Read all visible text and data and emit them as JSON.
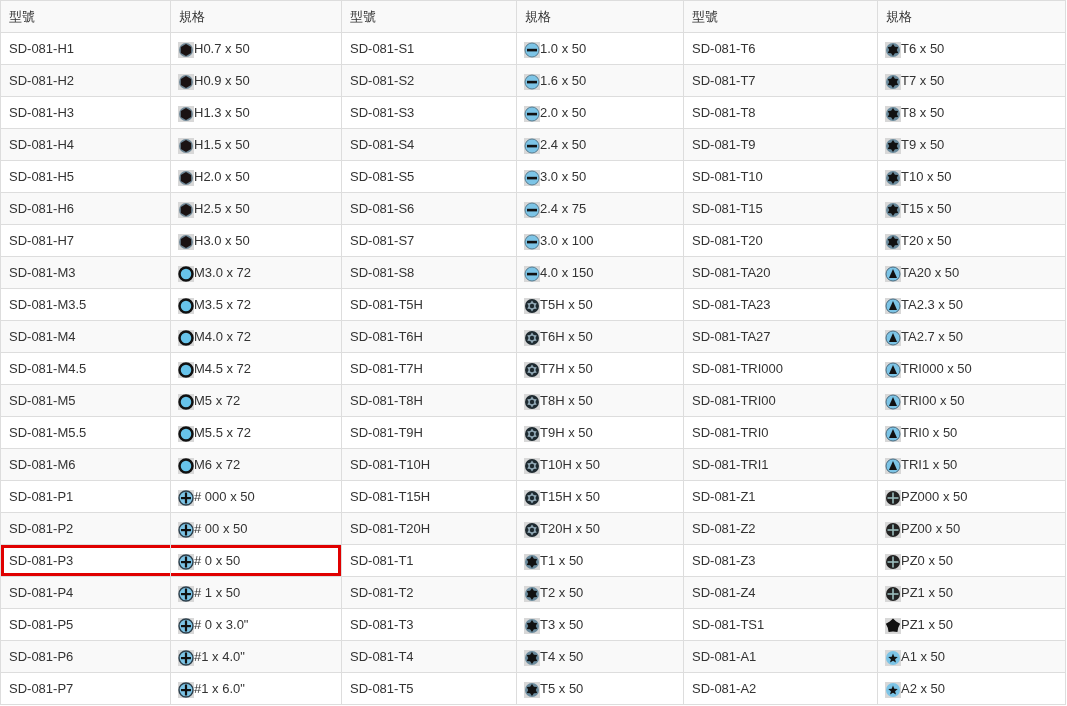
{
  "table": {
    "columns": [
      "型號",
      "規格",
      "型號",
      "規格",
      "型號",
      "規格"
    ],
    "rows": [
      {
        "items": [
          {
            "model": "SD-081-H1",
            "spec": "H0.7 x 50",
            "kind": "hex",
            "highlighted": false
          },
          {
            "model": "SD-081-S1",
            "spec": "1.0 x 50",
            "kind": "slot",
            "highlighted": false
          },
          {
            "model": "SD-081-T6",
            "spec": "T6 x 50",
            "kind": "torx",
            "highlighted": false
          }
        ]
      },
      {
        "items": [
          {
            "model": "SD-081-H2",
            "spec": "H0.9 x 50",
            "kind": "hex",
            "highlighted": false
          },
          {
            "model": "SD-081-S2",
            "spec": "1.6 x 50",
            "kind": "slot",
            "highlighted": false
          },
          {
            "model": "SD-081-T7",
            "spec": "T7 x 50",
            "kind": "torx",
            "highlighted": false
          }
        ]
      },
      {
        "items": [
          {
            "model": "SD-081-H3",
            "spec": "H1.3 x 50",
            "kind": "hex",
            "highlighted": false
          },
          {
            "model": "SD-081-S3",
            "spec": "2.0 x 50",
            "kind": "slot",
            "highlighted": false
          },
          {
            "model": "SD-081-T8",
            "spec": "T8 x 50",
            "kind": "torx",
            "highlighted": false
          }
        ]
      },
      {
        "items": [
          {
            "model": "SD-081-H4",
            "spec": "H1.5 x 50",
            "kind": "hex",
            "highlighted": false
          },
          {
            "model": "SD-081-S4",
            "spec": "2.4 x 50",
            "kind": "slot",
            "highlighted": false
          },
          {
            "model": "SD-081-T9",
            "spec": "T9 x 50",
            "kind": "torx",
            "highlighted": false
          }
        ]
      },
      {
        "items": [
          {
            "model": "SD-081-H5",
            "spec": "H2.0 x 50",
            "kind": "hex",
            "highlighted": false
          },
          {
            "model": "SD-081-S5",
            "spec": "3.0 x 50",
            "kind": "slot",
            "highlighted": false
          },
          {
            "model": "SD-081-T10",
            "spec": "T10 x 50",
            "kind": "torx",
            "highlighted": false
          }
        ]
      },
      {
        "items": [
          {
            "model": "SD-081-H6",
            "spec": "H2.5 x 50",
            "kind": "hex",
            "highlighted": false
          },
          {
            "model": "SD-081-S6",
            "spec": "2.4 x 75",
            "kind": "slot",
            "highlighted": false
          },
          {
            "model": "SD-081-T15",
            "spec": "T15 x 50",
            "kind": "torx",
            "highlighted": false
          }
        ]
      },
      {
        "items": [
          {
            "model": "SD-081-H7",
            "spec": "H3.0 x 50",
            "kind": "hex",
            "highlighted": false
          },
          {
            "model": "SD-081-S7",
            "spec": "3.0 x 100",
            "kind": "slot",
            "highlighted": false
          },
          {
            "model": "SD-081-T20",
            "spec": "T20 x 50",
            "kind": "torx",
            "highlighted": false
          }
        ]
      },
      {
        "items": [
          {
            "model": "SD-081-M3",
            "spec": "M3.0 x 72",
            "kind": "ring",
            "highlighted": false
          },
          {
            "model": "SD-081-S8",
            "spec": "4.0 x 150",
            "kind": "slot",
            "highlighted": false
          },
          {
            "model": "SD-081-TA20",
            "spec": "TA20 x 50",
            "kind": "tri",
            "highlighted": false
          }
        ]
      },
      {
        "items": [
          {
            "model": "SD-081-M3.5",
            "spec": "M3.5 x 72",
            "kind": "ring",
            "highlighted": false
          },
          {
            "model": "SD-081-T5H",
            "spec": "T5H x 50",
            "kind": "torxh",
            "highlighted": false
          },
          {
            "model": "SD-081-TA23",
            "spec": "TA2.3 x 50",
            "kind": "tri",
            "highlighted": false
          }
        ]
      },
      {
        "items": [
          {
            "model": "SD-081-M4",
            "spec": "M4.0 x 72",
            "kind": "ring",
            "highlighted": false
          },
          {
            "model": "SD-081-T6H",
            "spec": "T6H x 50",
            "kind": "torxh",
            "highlighted": false
          },
          {
            "model": "SD-081-TA27",
            "spec": "TA2.7 x 50",
            "kind": "tri",
            "highlighted": false
          }
        ]
      },
      {
        "items": [
          {
            "model": "SD-081-M4.5",
            "spec": "M4.5 x 72",
            "kind": "ring",
            "highlighted": false
          },
          {
            "model": "SD-081-T7H",
            "spec": "T7H x 50",
            "kind": "torxh",
            "highlighted": false
          },
          {
            "model": "SD-081-TRI000",
            "spec": "TRI000 x 50",
            "kind": "tri",
            "highlighted": false
          }
        ]
      },
      {
        "items": [
          {
            "model": "SD-081-M5",
            "spec": "M5 x 72",
            "kind": "ring",
            "highlighted": false
          },
          {
            "model": "SD-081-T8H",
            "spec": "T8H x 50",
            "kind": "torxh",
            "highlighted": false
          },
          {
            "model": "SD-081-TRI00",
            "spec": "TRI00 x 50",
            "kind": "tri",
            "highlighted": false
          }
        ]
      },
      {
        "items": [
          {
            "model": "SD-081-M5.5",
            "spec": "M5.5 x 72",
            "kind": "ring",
            "highlighted": false
          },
          {
            "model": "SD-081-T9H",
            "spec": "T9H x 50",
            "kind": "torxh",
            "highlighted": false
          },
          {
            "model": "SD-081-TRI0",
            "spec": "TRI0 x 50",
            "kind": "tri",
            "highlighted": false
          }
        ]
      },
      {
        "items": [
          {
            "model": "SD-081-M6",
            "spec": "M6 x 72",
            "kind": "ring",
            "highlighted": false
          },
          {
            "model": "SD-081-T10H",
            "spec": "T10H x 50",
            "kind": "torxh",
            "highlighted": false
          },
          {
            "model": "SD-081-TRI1",
            "spec": "TRI1 x 50",
            "kind": "tri",
            "highlighted": false
          }
        ]
      },
      {
        "items": [
          {
            "model": "SD-081-P1",
            "spec": "# 000 x 50",
            "kind": "phillips",
            "highlighted": false
          },
          {
            "model": "SD-081-T15H",
            "spec": "T15H x 50",
            "kind": "torxh",
            "highlighted": false
          },
          {
            "model": "SD-081-Z1",
            "spec": "PZ000 x 50",
            "kind": "pozi",
            "highlighted": false
          }
        ]
      },
      {
        "items": [
          {
            "model": "SD-081-P2",
            "spec": "# 00 x 50",
            "kind": "phillips",
            "highlighted": false
          },
          {
            "model": "SD-081-T20H",
            "spec": "T20H x 50",
            "kind": "torxh",
            "highlighted": false
          },
          {
            "model": "SD-081-Z2",
            "spec": "PZ00 x 50",
            "kind": "pozi",
            "highlighted": false
          }
        ]
      },
      {
        "items": [
          {
            "model": "SD-081-P3",
            "spec": "# 0 x 50",
            "kind": "phillips",
            "highlighted": true
          },
          {
            "model": "SD-081-T1",
            "spec": "T1 x 50",
            "kind": "torx",
            "highlighted": false
          },
          {
            "model": "SD-081-Z3",
            "spec": "PZ0 x 50",
            "kind": "pozi",
            "highlighted": false
          }
        ]
      },
      {
        "items": [
          {
            "model": "SD-081-P4",
            "spec": "# 1 x 50",
            "kind": "phillips",
            "highlighted": false
          },
          {
            "model": "SD-081-T2",
            "spec": "T2 x 50",
            "kind": "torx",
            "highlighted": false
          },
          {
            "model": "SD-081-Z4",
            "spec": "PZ1 x 50",
            "kind": "pozi",
            "highlighted": false
          }
        ]
      },
      {
        "items": [
          {
            "model": "SD-081-P5",
            "spec": "# 0 x 3.0\"",
            "kind": "phillips",
            "highlighted": false
          },
          {
            "model": "SD-081-T3",
            "spec": "T3 x 50",
            "kind": "torx",
            "highlighted": false
          },
          {
            "model": "SD-081-TS1",
            "spec": "PZ1 x 50",
            "kind": "penta",
            "highlighted": false
          }
        ]
      },
      {
        "items": [
          {
            "model": "SD-081-P6",
            "spec": "#1 x 4.0\"",
            "kind": "phillips",
            "highlighted": false
          },
          {
            "model": "SD-081-T4",
            "spec": "T4 x 50",
            "kind": "torx",
            "highlighted": false
          },
          {
            "model": "SD-081-A1",
            "spec": "A1 x 50",
            "kind": "star",
            "highlighted": false
          }
        ]
      },
      {
        "items": [
          {
            "model": "SD-081-P7",
            "spec": "#1 x 6.0\"",
            "kind": "phillips",
            "highlighted": false
          },
          {
            "model": "SD-081-T5",
            "spec": "T5 x 50",
            "kind": "torx",
            "highlighted": false
          },
          {
            "model": "SD-081-A2",
            "spec": "A2 x 50",
            "kind": "star",
            "highlighted": false
          }
        ]
      }
    ]
  }
}
